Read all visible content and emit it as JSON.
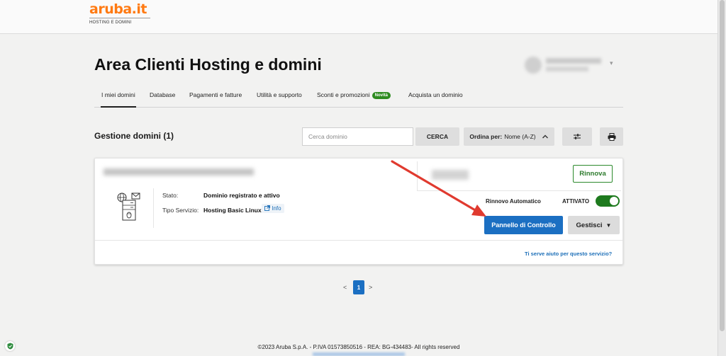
{
  "logo": {
    "text": "aruba.it",
    "subtitle": "HOSTING E DOMINI"
  },
  "page": {
    "title": "Area Clienti Hosting e domini"
  },
  "tabs": [
    {
      "label": "I miei domini",
      "active": true
    },
    {
      "label": "Database"
    },
    {
      "label": "Pagamenti e fatture"
    },
    {
      "label": "Utilità e supporto"
    },
    {
      "label": "Sconti e promozioni",
      "badge": "Novità"
    },
    {
      "label": "Acquista un dominio"
    }
  ],
  "section": {
    "title": "Gestione domini (1)"
  },
  "search": {
    "placeholder": "Cerca dominio",
    "button": "CERCA"
  },
  "sort": {
    "label": "Ordina per:",
    "value": "Nome (A-Z)"
  },
  "card": {
    "status_label": "Stato:",
    "status_value": "Dominio registrato e attivo",
    "service_label": "Tipo Servizio:",
    "service_value": "Hosting Basic Linux",
    "info_link": "Info",
    "renew_button": "Rinnova",
    "auto_renew_label": "Rinnovo Automatico",
    "auto_renew_status": "ATTIVATO",
    "auto_renew_on": true,
    "control_panel_button": "Pannello di Controllo",
    "manage_button": "Gestisci",
    "help_link": "Ti serve aiuto per questo servizio?"
  },
  "pagination": {
    "prev": "<",
    "current": "1",
    "next": ">"
  },
  "footer": {
    "copyright": "©2023 Aruba S.p.A. - P.IVA 01573850516 - REA: BG-434483- All rights reserved"
  },
  "colors": {
    "accent": "#1b6fc2",
    "brand": "#ff7a12",
    "success": "#1e7a1e",
    "annotation": "#e03a2f"
  }
}
